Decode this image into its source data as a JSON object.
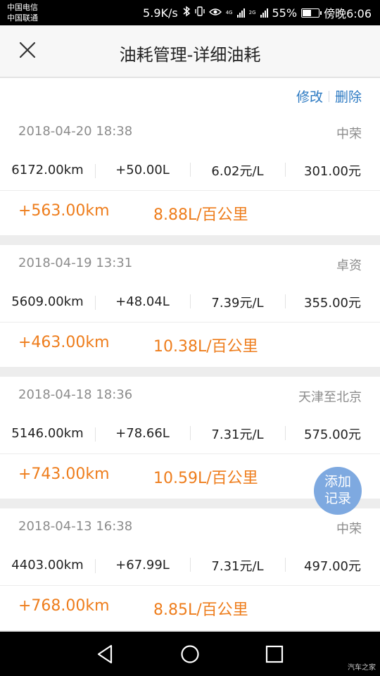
{
  "status_bar": {
    "carrier_1": "中国电信",
    "carrier_2": "中国联通",
    "speed": "5.9K/s",
    "net_4g": "4G",
    "net_2g": "2G",
    "battery": "55%",
    "battery_level": 0.55,
    "time": "傍晚6:06"
  },
  "header": {
    "title": "油耗管理-详细油耗",
    "close_icon": "close-icon"
  },
  "actions": {
    "edit": "修改",
    "delete": "删除"
  },
  "records": [
    {
      "date": "2018-04-20 18:38",
      "station": "中荣",
      "mileage": "6172.00km",
      "fuel": "+50.00L",
      "price": "6.02元/L",
      "cost": "301.00元",
      "distance": "+563.00km",
      "consumption": "8.88L/百公里"
    },
    {
      "date": "2018-04-19 13:31",
      "station": "卓资",
      "mileage": "5609.00km",
      "fuel": "+48.04L",
      "price": "7.39元/L",
      "cost": "355.00元",
      "distance": "+463.00km",
      "consumption": "10.38L/百公里"
    },
    {
      "date": "2018-04-18 18:36",
      "station": "天津至北京",
      "mileage": "5146.00km",
      "fuel": "+78.66L",
      "price": "7.31元/L",
      "cost": "575.00元",
      "distance": "+743.00km",
      "consumption": "10.59L/百公里"
    },
    {
      "date": "2018-04-13 16:38",
      "station": "中荣",
      "mileage": "4403.00km",
      "fuel": "+67.99L",
      "price": "7.31元/L",
      "cost": "497.00元",
      "distance": "+768.00km",
      "consumption": "8.85L/百公里"
    }
  ],
  "fab": {
    "line1": "添加",
    "line2": "记录"
  },
  "nav": {
    "back_icon": "back-triangle-icon",
    "home_icon": "home-circle-icon",
    "recents_icon": "recents-square-icon"
  },
  "watermark": "汽车之家",
  "colors": {
    "accent_orange": "#ee7d1c",
    "link_blue": "#2b79c2",
    "fab_blue": "#7ea9e0"
  }
}
